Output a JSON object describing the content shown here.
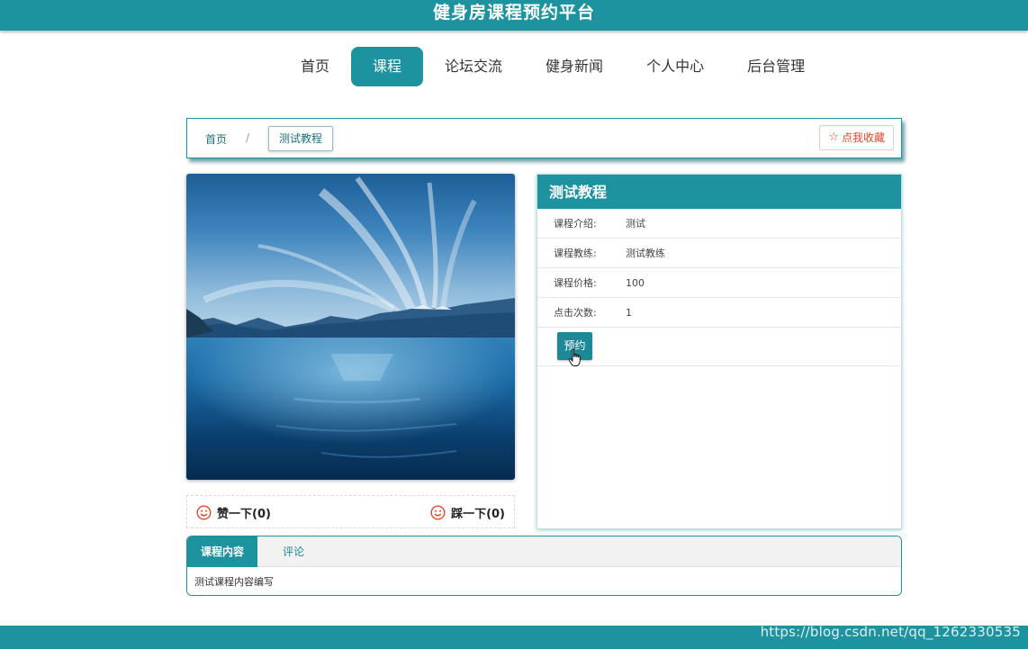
{
  "site_title": "健身房课程预约平台",
  "nav": {
    "items": [
      {
        "label": "首页",
        "active": false
      },
      {
        "label": "课程",
        "active": true
      },
      {
        "label": "论坛交流",
        "active": false
      },
      {
        "label": "健身新闻",
        "active": false
      },
      {
        "label": "个人中心",
        "active": false
      },
      {
        "label": "后台管理",
        "active": false
      }
    ]
  },
  "breadcrumb": {
    "home": "首页",
    "separator": "/",
    "current": "测试教程"
  },
  "favorite": {
    "label": "点我收藏",
    "icon": "star-outline-icon"
  },
  "votes": {
    "up_label": "赞一下(0)",
    "down_label": "踩一下(0)",
    "icon": "smile-icon"
  },
  "course": {
    "title": "测试教程",
    "fields": [
      {
        "key": "课程介绍:",
        "value": "测试"
      },
      {
        "key": "课程教练:",
        "value": "测试教练"
      },
      {
        "key": "课程价格:",
        "value": "100"
      },
      {
        "key": "点击次数:",
        "value": "1"
      }
    ],
    "book_label": "预约"
  },
  "tabs": {
    "items": [
      {
        "label": "课程内容",
        "active": true
      },
      {
        "label": "评论",
        "active": false
      }
    ],
    "content": "测试课程内容编写"
  },
  "watermark": "https://blog.csdn.net/qq_1262330535",
  "colors": {
    "primary": "#1e93a0",
    "favorite": "#e4472a",
    "smile": "#e4472a"
  }
}
